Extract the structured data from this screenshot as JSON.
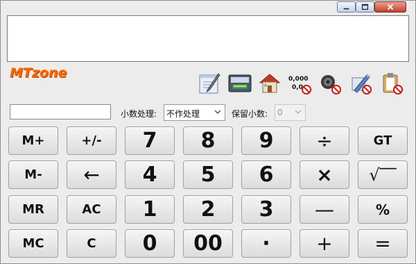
{
  "window": {
    "controls": {
      "minimize": "minimize-icon",
      "maximize": "maximize-icon",
      "close": "close-icon"
    }
  },
  "display": {
    "value": ""
  },
  "logo": {
    "text": "MTzone"
  },
  "toolbar": {
    "icons": [
      "notepad-icon",
      "keyboard-icon",
      "home-icon",
      "number-format-icon",
      "sound-off-icon",
      "tools-off-icon",
      "clipboard-off-icon"
    ],
    "number_format_text_top": "0,000",
    "number_format_text_bottom": "0,0"
  },
  "settings": {
    "decimal_handling_label": "小数处理:",
    "decimal_handling_value": "不作处理",
    "decimal_places_label": "保留小数:",
    "decimal_places_value": "0"
  },
  "keypad": {
    "rows": [
      [
        "M+",
        "+/-",
        "7",
        "8",
        "9",
        "÷",
        "GT"
      ],
      [
        "M-",
        "←",
        "4",
        "5",
        "6",
        "×",
        "√‾‾"
      ],
      [
        "MR",
        "AC",
        "1",
        "2",
        "3",
        "—",
        "%"
      ],
      [
        "MC",
        "C",
        "0",
        "00",
        "·",
        "+",
        "="
      ]
    ]
  },
  "colors": {
    "logo": "#ff6600",
    "background": "#ececec",
    "key_border": "#9f9f9f"
  }
}
